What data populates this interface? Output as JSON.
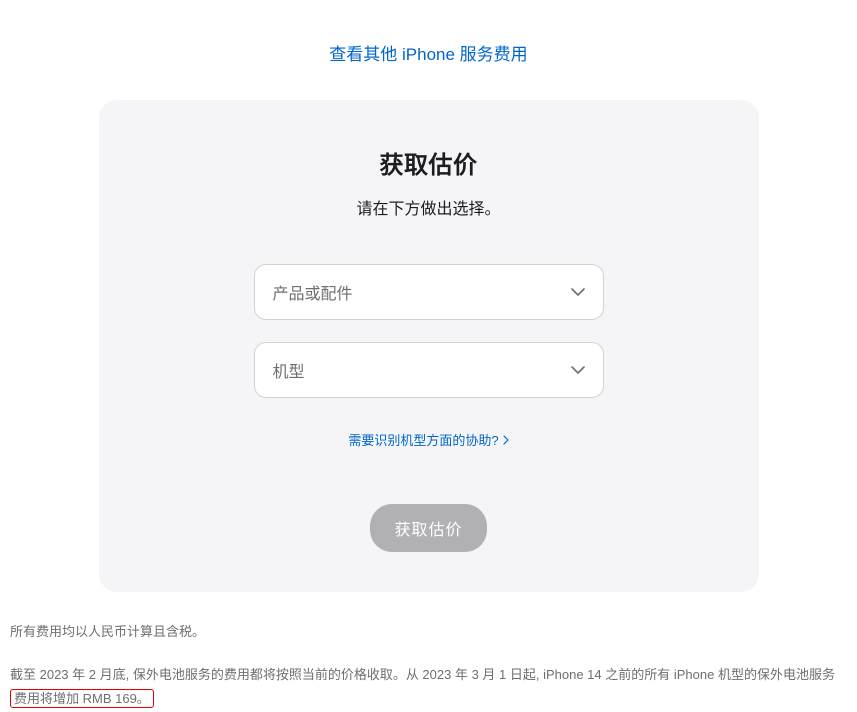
{
  "topLink": "查看其他 iPhone 服务费用",
  "card": {
    "title": "获取估价",
    "subtitle": "请在下方做出选择。",
    "select1Placeholder": "产品或配件",
    "select2Placeholder": "机型",
    "helpLink": "需要识别机型方面的协助?",
    "submitButton": "获取估价"
  },
  "footer": {
    "para1": "所有费用均以人民币计算且含税。",
    "para2Start": "截至 2023 年 2 月底, 保外电池服务的费用都将按照当前的价格收取。从 2023 年 3 月 1 日起, iPhone 14 之前的所有 iPhone 机型的保外电池服务",
    "para2Highlight": "费用将增加 RMB 169。"
  }
}
